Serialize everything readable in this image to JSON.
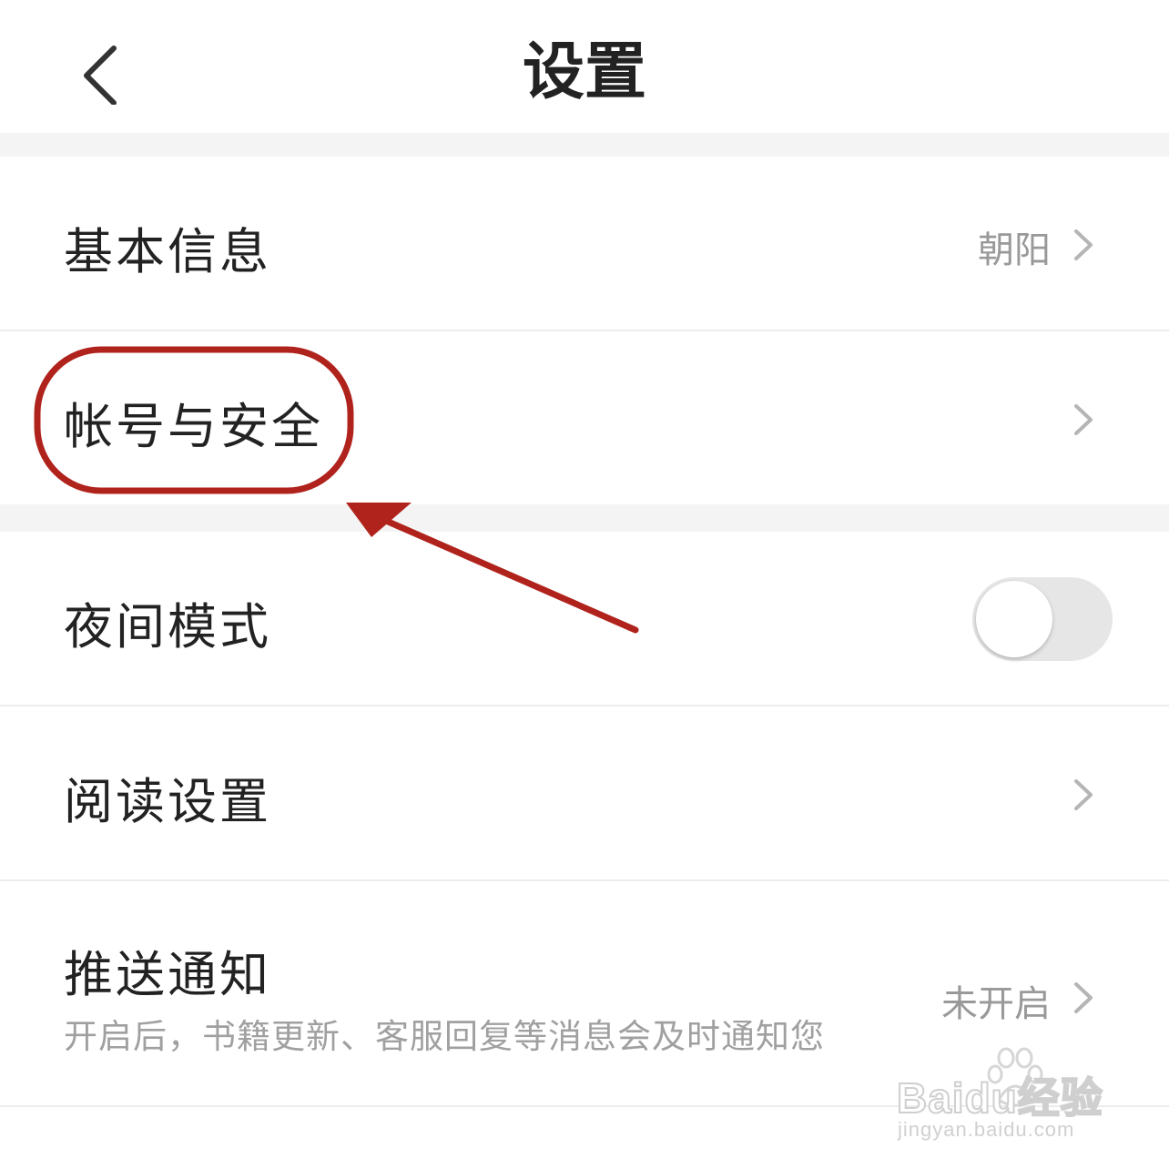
{
  "header": {
    "title": "设置",
    "back_icon": "chevron-left-icon"
  },
  "items": [
    {
      "label": "基本信息",
      "value": "朝阳",
      "control": "chevron-right-icon"
    },
    {
      "label": "帐号与安全",
      "value": "",
      "control": "chevron-right-icon",
      "highlighted": true
    },
    {
      "label": "夜间模式",
      "control": "toggle",
      "toggle_on": false
    },
    {
      "label": "阅读设置",
      "value": "",
      "control": "chevron-right-icon"
    },
    {
      "label": "推送通知",
      "value": "未开启",
      "sub": "开启后，书籍更新、客服回复等消息会及时通知您",
      "control": "chevron-right-icon"
    }
  ],
  "watermark": {
    "brand": "Baidu经验",
    "url": "jingyan.baidu.com"
  },
  "colors": {
    "annotation": "#b0231c",
    "text_primary": "#222222",
    "text_secondary": "#999999",
    "section_gap": "#f4f4f4",
    "toggle_off": "#e6e6e6"
  }
}
